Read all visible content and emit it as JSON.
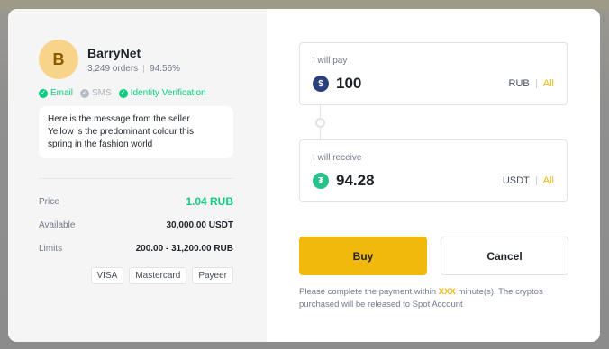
{
  "seller": {
    "avatar_letter": "B",
    "name": "BarryNet",
    "orders": "3,249 orders",
    "completion": "94.56%",
    "verifications": [
      {
        "label": "Email",
        "status": "verified"
      },
      {
        "label": "SMS",
        "status": "unverified"
      },
      {
        "label": "Identity Verification",
        "status": "verified"
      }
    ],
    "message": {
      "line1": "Here is the message from the seller",
      "line2": "Yellow is the predominant colour this",
      "line3": "spring in the fashion world"
    }
  },
  "details": {
    "price_label": "Price",
    "price_value": "1.04 RUB",
    "available_label": "Available",
    "available_value": "30,000.00 USDT",
    "limits_label": "Limits",
    "limits_value": "200.00 - 31,200.00 RUB"
  },
  "payment_methods": [
    "VISA",
    "Mastercard",
    "Payeer"
  ],
  "pay_field": {
    "label": "I will pay",
    "icon": "dollar-coin-icon",
    "amount": "100",
    "currency": "RUB",
    "all_label": "All"
  },
  "receive_field": {
    "label": "I will receive",
    "icon": "tether-coin-icon",
    "amount": "94.28",
    "currency": "USDT",
    "all_label": "All"
  },
  "actions": {
    "buy_label": "Buy",
    "cancel_label": "Cancel"
  },
  "note": {
    "before": "Please complete the payment within ",
    "highlight": "XXX",
    "after": " minute(s). The cryptos purchased will be released to Spot Account"
  },
  "colors": {
    "accent": "#f0b90b",
    "success": "#0ecb81",
    "muted_text": "#707a8a",
    "avatar_bg": "#f8d38a"
  }
}
